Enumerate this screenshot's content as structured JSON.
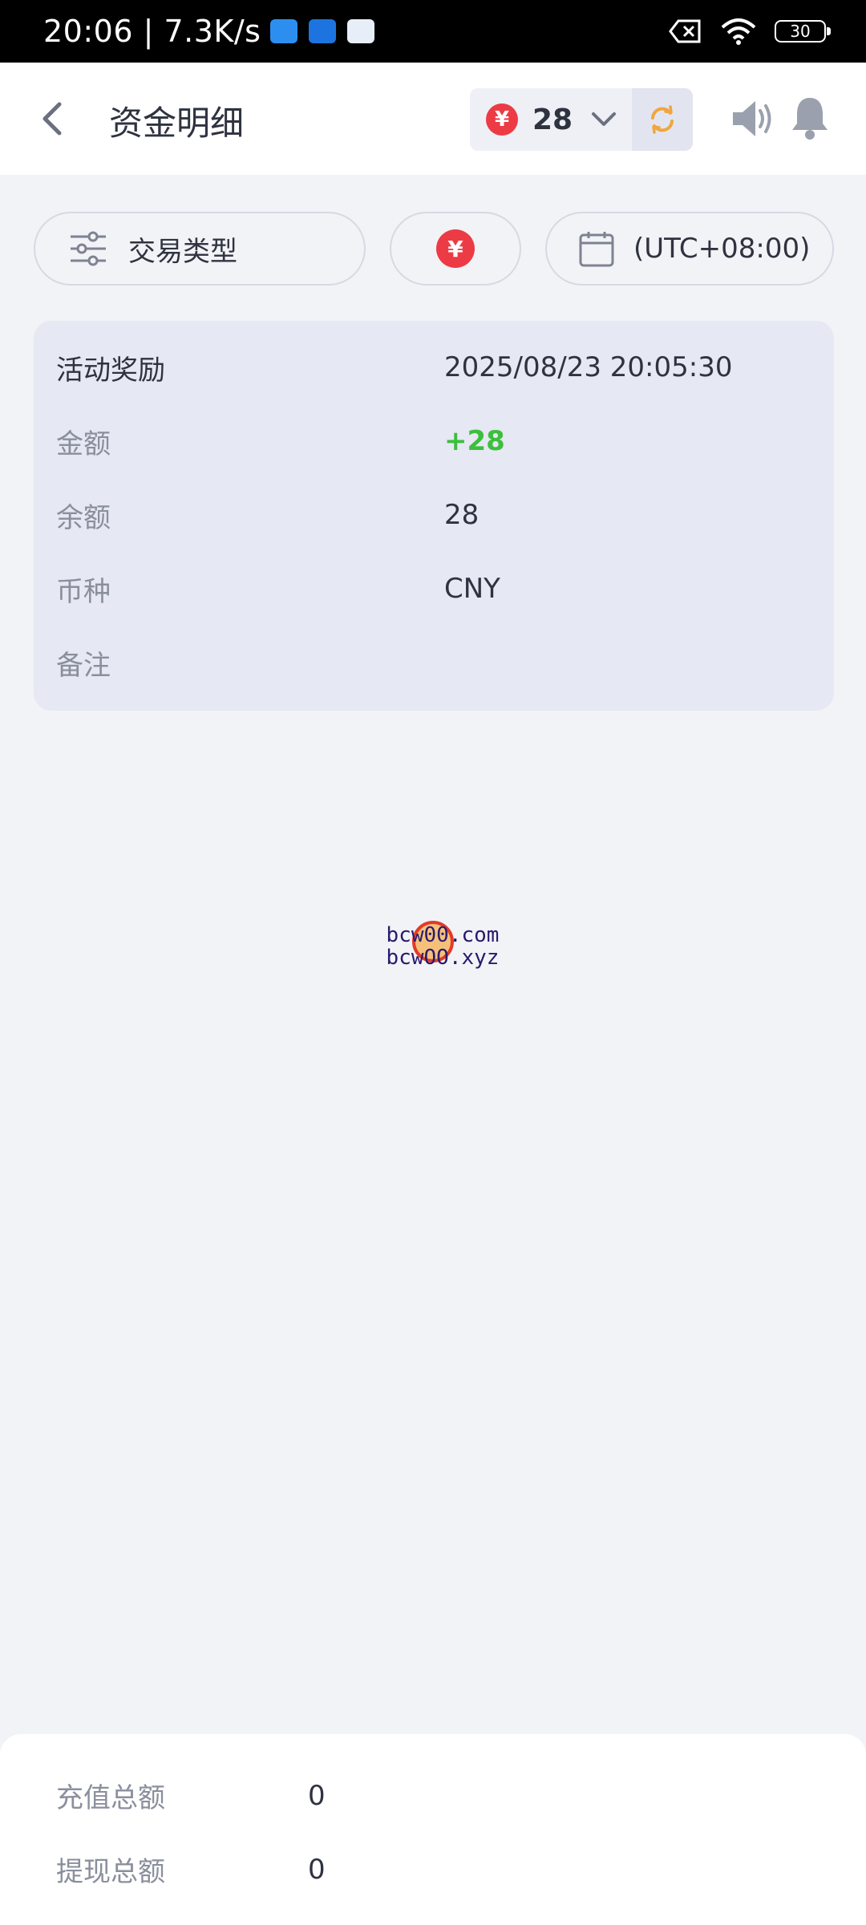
{
  "status_bar": {
    "time_speed": "20:06 | 7.3K/s",
    "battery": "30"
  },
  "header": {
    "title": "资金明细",
    "balance": "28",
    "currency_symbol": "¥"
  },
  "filters": {
    "transaction_type": "交易类型",
    "timezone": "(UTC+08:00)"
  },
  "record": {
    "type": "活动奖励",
    "datetime": "2025/08/23 20:05:30",
    "amount_label": "金额",
    "amount": "+28",
    "balance_label": "余额",
    "balance": "28",
    "currency_label": "币种",
    "currency": "CNY",
    "note_label": "备注",
    "note": ""
  },
  "watermark": {
    "line1": "bcw00.com",
    "line2": "bcwOO.xyz"
  },
  "summary": {
    "deposit_label": "充值总额",
    "deposit_value": "0",
    "withdraw_label": "提现总额",
    "withdraw_value": "0"
  },
  "colors": {
    "accent_red": "#ec3b45",
    "positive_green": "#3cbf3c",
    "refresh_orange": "#f0a640"
  }
}
